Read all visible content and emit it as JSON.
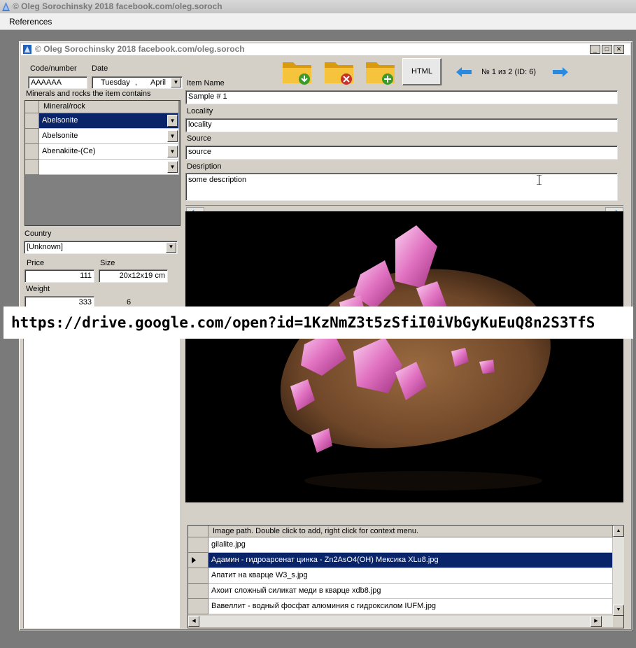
{
  "outer_window": {
    "title": "© Oleg Sorochinsky 2018 facebook.com/oleg.soroch"
  },
  "menu": {
    "items": [
      "References"
    ]
  },
  "window": {
    "title": "© Oleg Sorochinsky 2018 facebook.com/oleg.soroch",
    "minimize": "_",
    "maximize": "□",
    "close": "✕"
  },
  "form": {
    "code_label": "Code/number",
    "code_value": "AAAAAA",
    "date_label": "Date",
    "date_day": "Tuesday",
    "date_sep": ",",
    "date_month": "April",
    "minerals_label": "Minerals and rocks the item contains",
    "minerals_column": "Mineral/rock",
    "minerals": [
      "Abelsonite",
      "Abelsonite",
      "Abenakiite-(Ce)",
      ""
    ],
    "country_label": "Country",
    "country_value": "[Unknown]",
    "price_label": "Price",
    "price_value": "111",
    "size_label": "Size",
    "size_value": "20x12x19 cm",
    "weight_label": "Weight",
    "weight_value": "333",
    "weight_extra": "6",
    "item_name_label": "Item Name",
    "item_name_value": "Sample # 1",
    "locality_label": "Locality",
    "locality_value": "locality",
    "source_label": "Source",
    "source_value": "source",
    "description_label": "Desription",
    "description_value": "some description"
  },
  "toolbar": {
    "html_label": "HTML",
    "record_counter": "№ 1 из 2 (ID: 6)"
  },
  "images": {
    "column_header": "Image path. Double click to add, right click for context menu.",
    "rows": [
      "gilalite.jpg",
      "Адамин - гидроарсенат цинка - Zn2AsO4(OH) Мексика XLu8.jpg",
      "Апатит на кварце W3_s.jpg",
      "Ахоит  сложный силикат меди в кварце xdb8.jpg",
      "Вавеллит - водный фосфат алюминия с гидроксилом IUFM.jpg"
    ],
    "selected_index": 1
  },
  "banner": {
    "text": "https://drive.google.com/open?id=1KzNmZ3t5zSfiI0iVbGyKuEuQ8n2S3TfS"
  },
  "icons": [
    "app-logo-icon",
    "folder-download-icon",
    "folder-delete-icon",
    "folder-add-icon",
    "arrow-left-icon",
    "arrow-right-icon",
    "chevron-down-icon",
    "row-pointer-icon",
    "text-cursor-icon"
  ],
  "colors": {
    "selection": "#0a246a",
    "arrow_blue": "#2a8ae0",
    "folder": "#f0b020",
    "mineral_pink": "#e070c0",
    "matrix_brown": "#7a5030"
  }
}
